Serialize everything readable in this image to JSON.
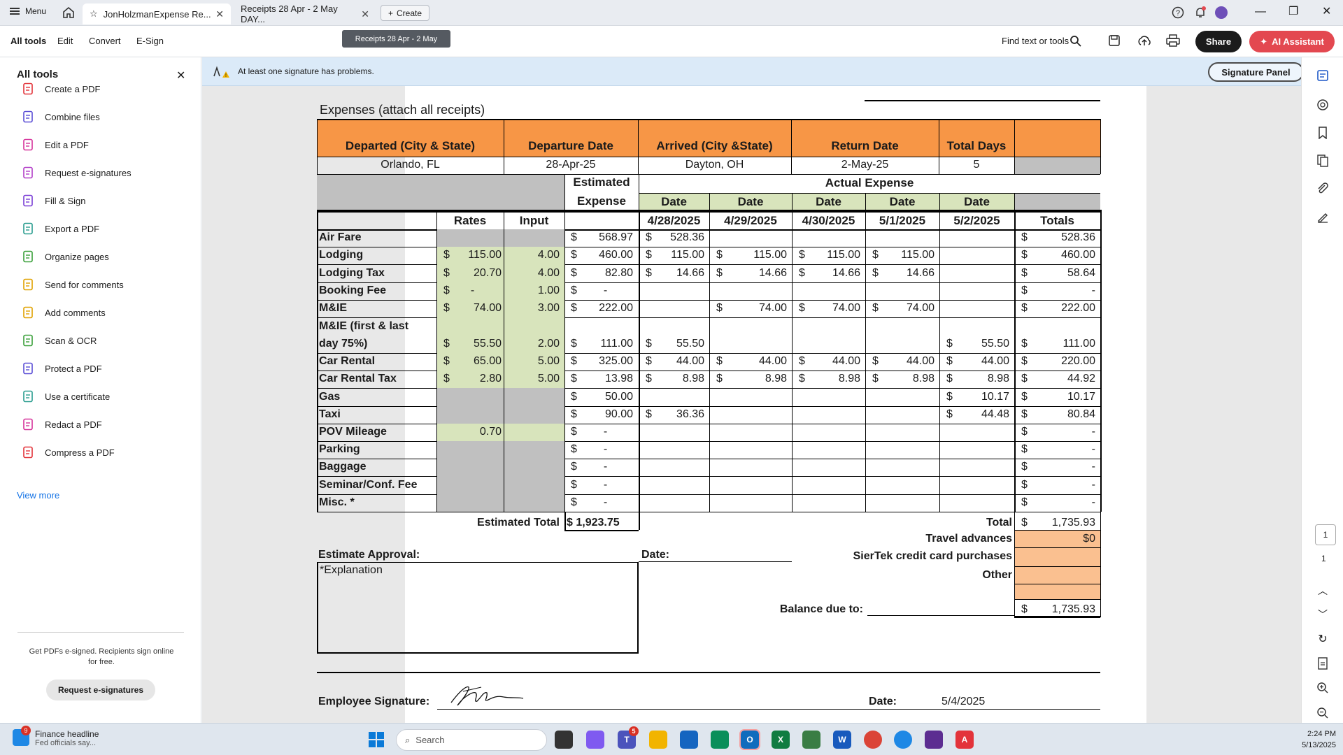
{
  "titlebar": {
    "menu_label": "Menu",
    "tabs": [
      "JonHolzmanExpense Re...",
      "Receipts 28 Apr - 2 May DAY..."
    ],
    "create_label": "Create",
    "tooltip": "Receipts 28 Apr - 2 May"
  },
  "toolbar": {
    "menus": [
      "All tools",
      "Edit",
      "Convert",
      "E-Sign"
    ],
    "find_label": "Find text or tools",
    "share_label": "Share",
    "ai_label": "AI Assistant"
  },
  "leftpanel": {
    "title": "All tools",
    "items": [
      {
        "label": "Create a PDF",
        "icon": "create-pdf-icon",
        "color": "#e3333a"
      },
      {
        "label": "Combine files",
        "icon": "combine-files-icon",
        "color": "#5b4fd6"
      },
      {
        "label": "Edit a PDF",
        "icon": "edit-pdf-icon",
        "color": "#d6339b"
      },
      {
        "label": "Request e-signatures",
        "icon": "request-esign-icon",
        "color": "#b23ec8"
      },
      {
        "label": "Fill & Sign",
        "icon": "fill-sign-icon",
        "color": "#7a3ed6"
      },
      {
        "label": "Export a PDF",
        "icon": "export-pdf-icon",
        "color": "#2a9d8f"
      },
      {
        "label": "Organize pages",
        "icon": "organize-pages-icon",
        "color": "#3aa03a"
      },
      {
        "label": "Send for comments",
        "icon": "send-comments-icon",
        "color": "#e0a100"
      },
      {
        "label": "Add comments",
        "icon": "add-comments-icon",
        "color": "#e0a100"
      },
      {
        "label": "Scan & OCR",
        "icon": "scan-ocr-icon",
        "color": "#3aa03a"
      },
      {
        "label": "Protect a PDF",
        "icon": "protect-pdf-icon",
        "color": "#5b4fd6"
      },
      {
        "label": "Use a certificate",
        "icon": "certificate-icon",
        "color": "#2a9d8f"
      },
      {
        "label": "Redact a PDF",
        "icon": "redact-pdf-icon",
        "color": "#d6339b"
      },
      {
        "label": "Compress a PDF",
        "icon": "compress-pdf-icon",
        "color": "#e3333a"
      }
    ],
    "view_more": "View more",
    "note": "Get PDFs e-signed. Recipients sign online for free.",
    "request_button": "Request e-signatures"
  },
  "banner": {
    "message": "At least one signature has problems.",
    "signature_panel": "Signature Panel"
  },
  "pager": {
    "current": "1",
    "total": "1"
  },
  "form": {
    "section_title": "Expenses  (attach all receipts)",
    "trip_headers": [
      "Departed (City & State)",
      "Departure Date",
      "Arrived (City &State)",
      "Return Date",
      "Total Days"
    ],
    "trip_values": [
      "Orlando, FL",
      "28-Apr-25",
      "Dayton, OH",
      "2-May-25",
      "5"
    ],
    "estimated_label": "Estimated",
    "expense_label": "Expense",
    "actual_expense_label": "Actual Expense",
    "date_label": "Date",
    "col_rates": "Rates",
    "col_input": "Input",
    "col_totals": "Totals",
    "dates": [
      "4/28/2025",
      "4/29/2025",
      "4/30/2025",
      "5/1/2025",
      "5/2/2025"
    ],
    "rows": [
      {
        "label": "Air Fare",
        "rate": "",
        "input": "",
        "est": "568.97",
        "d": [
          "528.36",
          "",
          "",
          "",
          ""
        ],
        "total": "528.36"
      },
      {
        "label": "Lodging",
        "rate": "115.00",
        "input": "4.00",
        "est": "460.00",
        "d": [
          "115.00",
          "115.00",
          "115.00",
          "115.00",
          ""
        ],
        "total": "460.00"
      },
      {
        "label": "Lodging Tax",
        "rate": "20.70",
        "input": "4.00",
        "est": "82.80",
        "d": [
          "14.66",
          "14.66",
          "14.66",
          "14.66",
          ""
        ],
        "total": "58.64"
      },
      {
        "label": "Booking Fee",
        "rate": "-",
        "input": "1.00",
        "est": "-",
        "d": [
          "",
          "",
          "",
          "",
          ""
        ],
        "total": "-"
      },
      {
        "label": "M&IE",
        "rate": "74.00",
        "input": "3.00",
        "est": "222.00",
        "d": [
          "",
          "74.00",
          "74.00",
          "74.00",
          ""
        ],
        "total": "222.00"
      },
      {
        "label": "M&IE (first & last|day 75%)",
        "rate": "55.50",
        "input": "2.00",
        "est": "111.00",
        "d": [
          "55.50",
          "",
          "",
          "",
          "55.50"
        ],
        "total": "111.00"
      },
      {
        "label": "Car Rental",
        "rate": "65.00",
        "input": "5.00",
        "est": "325.00",
        "d": [
          "44.00",
          "44.00",
          "44.00",
          "44.00",
          "44.00"
        ],
        "total": "220.00"
      },
      {
        "label": "Car Rental Tax",
        "rate": "2.80",
        "input": "5.00",
        "est": "13.98",
        "d": [
          "8.98",
          "8.98",
          "8.98",
          "8.98",
          "8.98"
        ],
        "total": "44.92"
      },
      {
        "label": "Gas",
        "rate": "",
        "input": "",
        "est": "50.00",
        "d": [
          "",
          "",
          "",
          "",
          "10.17"
        ],
        "total": "10.17"
      },
      {
        "label": "Taxi",
        "rate": "",
        "input": "",
        "est": "90.00",
        "d": [
          "36.36",
          "",
          "",
          "",
          "44.48"
        ],
        "total": "80.84"
      },
      {
        "label": "POV Mileage",
        "rate": "0.70",
        "input": "",
        "est": "-",
        "d": [
          "",
          "",
          "",
          "",
          ""
        ],
        "total": "-"
      },
      {
        "label": "Parking",
        "rate": "",
        "input": "",
        "est": "-",
        "d": [
          "",
          "",
          "",
          "",
          ""
        ],
        "total": "-"
      },
      {
        "label": "Baggage",
        "rate": "",
        "input": "",
        "est": "-",
        "d": [
          "",
          "",
          "",
          "",
          ""
        ],
        "total": "-"
      },
      {
        "label": "Seminar/Conf. Fee",
        "rate": "",
        "input": "",
        "est": "-",
        "d": [
          "",
          "",
          "",
          "",
          ""
        ],
        "total": "-"
      },
      {
        "label": "Misc. *",
        "rate": "",
        "input": "",
        "est": "-",
        "d": [
          "",
          "",
          "",
          "",
          ""
        ],
        "total": "-"
      }
    ],
    "currency": "$",
    "estimated_total_label": "Estimated Total",
    "estimated_total": "$  1,923.75",
    "total_label": "Total",
    "total_value": "1,735.93",
    "travel_advances_label": "Travel advances",
    "travel_advances_value": "$0",
    "cc_label": "SierTek credit card purchases",
    "other_label": "Other",
    "balance_label": "Balance due to:",
    "balance_value": "1,735.93",
    "estimate_approval": "Estimate Approval:",
    "date_colon": "Date:",
    "explanation": "*Explanation",
    "employee_signature": "Employee Signature:",
    "sig_date_label": "Date:",
    "sig_date": "5/4/2025"
  },
  "taskbar": {
    "news_badge": "9",
    "news_title": "Finance headline",
    "news_sub": "Fed officials say...",
    "search_placeholder": "Search",
    "teams_badge": "5",
    "time": "2:24 PM",
    "date": "5/13/2025"
  },
  "colors": {
    "orange_header": "#f79646",
    "green_cell": "#d8e4bc",
    "gray_cell": "#c0c0c0",
    "peach_cell": "#fac090",
    "banner_bg": "#dbeaf8",
    "ai_button": "#e34850"
  }
}
